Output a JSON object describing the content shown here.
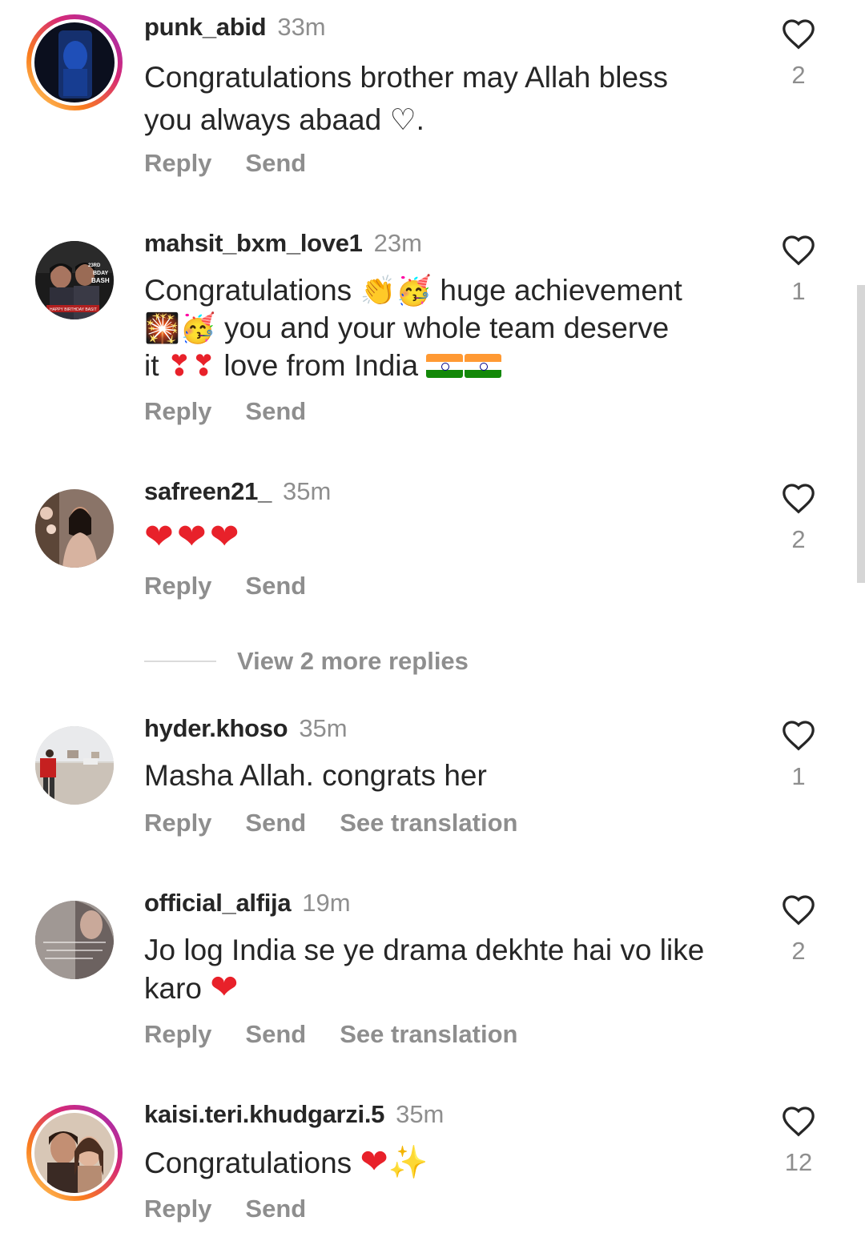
{
  "colors": {
    "username": "#262626",
    "meta": "#8e8e8e",
    "heart_outline": "#262626",
    "heart_red": "#e8212a",
    "story_ring": [
      "#feda75",
      "#fa7e1e",
      "#d62976",
      "#962fbf"
    ]
  },
  "action_labels": {
    "reply": "Reply",
    "send": "Send",
    "see_translation": "See translation"
  },
  "view_more_replies": "View 2 more replies",
  "comments": [
    {
      "username": "punk_abid",
      "time": "33m",
      "text_line1": "Congratulations brother may Allah bless",
      "text_line2": "you always abaad ♡.",
      "likes": "2",
      "avatar_icon": "avatar-story-ring"
    },
    {
      "username": "mahsit_bxm_love1",
      "time": "23m",
      "text_line1": "Congratulations",
      "text_line1b": "huge achievement",
      "text_line2": "you and your whole team deserve",
      "text_line3a": "it",
      "text_line3b": "love from India",
      "likes": "1",
      "avatar_text_1": "23RD",
      "avatar_text_2": "BDAY",
      "avatar_text_3": "BASH",
      "avatar_text_4": "HAPPY BIRTHDAY BASIT"
    },
    {
      "username": "safreen21_",
      "time": "35m",
      "text": "❤❤❤",
      "likes": "2"
    },
    {
      "username": "hyder.khoso",
      "time": "35m",
      "text": "Masha Allah. congrats her",
      "likes": "1"
    },
    {
      "username": "official_alfija",
      "time": "19m",
      "text_line1": "Jo log India se ye drama dekhte hai vo like",
      "text_line2": "karo",
      "likes": "2"
    },
    {
      "username": "kaisi.teri.khudgarzi.5",
      "time": "35m",
      "text": "Congratulations",
      "likes": "12"
    }
  ]
}
